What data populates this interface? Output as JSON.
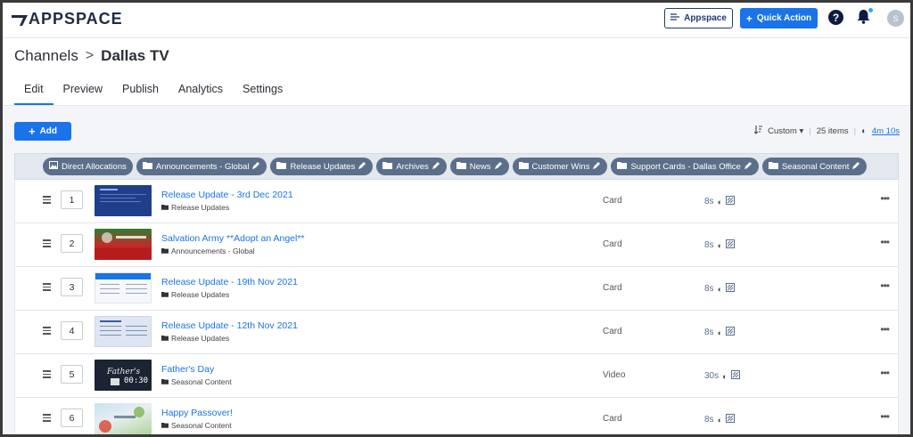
{
  "app": {
    "logo": "APPSPACE"
  },
  "topbar": {
    "appspace_label": "Appspace",
    "quick_action_label": "Quick Action",
    "help": "?",
    "avatar_initial": "S"
  },
  "breadcrumb": {
    "parent": "Channels",
    "separator": ">",
    "current": "Dallas TV"
  },
  "tabs": [
    {
      "label": "Edit",
      "active": true
    },
    {
      "label": "Preview"
    },
    {
      "label": "Publish"
    },
    {
      "label": "Analytics"
    },
    {
      "label": "Settings"
    }
  ],
  "toolbar": {
    "add_label": "Add",
    "sort_label": "Custom",
    "item_count": "25 items",
    "total_duration": "4m 10s"
  },
  "chips": [
    {
      "label": "Direct Allocations",
      "icon": "image-icon",
      "editable": false
    },
    {
      "label": "Announcements - Global",
      "icon": "folder-icon",
      "editable": true
    },
    {
      "label": "Release Updates",
      "icon": "folder-icon",
      "editable": true
    },
    {
      "label": "Archives",
      "icon": "folder-icon",
      "editable": true
    },
    {
      "label": "News",
      "icon": "folder-icon",
      "editable": true
    },
    {
      "label": "Customer Wins",
      "icon": "folder-icon",
      "editable": true
    },
    {
      "label": "Support Cards - Dallas Office",
      "icon": "folder-icon",
      "editable": true
    },
    {
      "label": "Seasonal Content",
      "icon": "folder-icon",
      "editable": true
    }
  ],
  "rows": [
    {
      "index": "1",
      "title": "Release Update - 3rd Dec 2021",
      "folder": "Release Updates",
      "type": "Card",
      "duration": "8s"
    },
    {
      "index": "2",
      "title": "Salvation Army **Adopt an Angel**",
      "folder": "Announcements - Global",
      "type": "Card",
      "duration": "8s"
    },
    {
      "index": "3",
      "title": "Release Update - 19th Nov 2021",
      "folder": "Release Updates",
      "type": "Card",
      "duration": "8s"
    },
    {
      "index": "4",
      "title": "Release Update - 12th Nov 2021",
      "folder": "Release Updates",
      "type": "Card",
      "duration": "8s"
    },
    {
      "index": "5",
      "title": "Father's Day",
      "folder": "Seasonal Content",
      "type": "Video",
      "duration": "30s",
      "thumb_text": "00:30"
    },
    {
      "index": "6",
      "title": "Happy Passover!",
      "folder": "Seasonal Content",
      "type": "Card",
      "duration": "8s"
    }
  ],
  "colors": {
    "accent": "#1a73e8",
    "chip": "#5c6f8a",
    "navy": "#0d1b3e"
  }
}
